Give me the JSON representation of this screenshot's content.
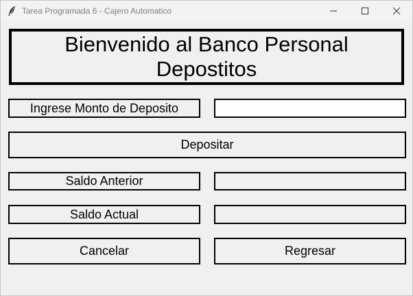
{
  "window": {
    "title": "Tarea Programada 6 - Cajero Automatico"
  },
  "header": {
    "line1": "Bienvenido al Banco Personal",
    "line2": "Depostitos"
  },
  "deposit": {
    "label": "Ingrese Monto de Deposito",
    "amount_value": "",
    "button": "Depositar"
  },
  "balances": {
    "previous_label": "Saldo Anterior",
    "previous_value": "",
    "current_label": "Saldo Actual",
    "current_value": ""
  },
  "actions": {
    "cancel": "Cancelar",
    "back": "Regresar"
  }
}
